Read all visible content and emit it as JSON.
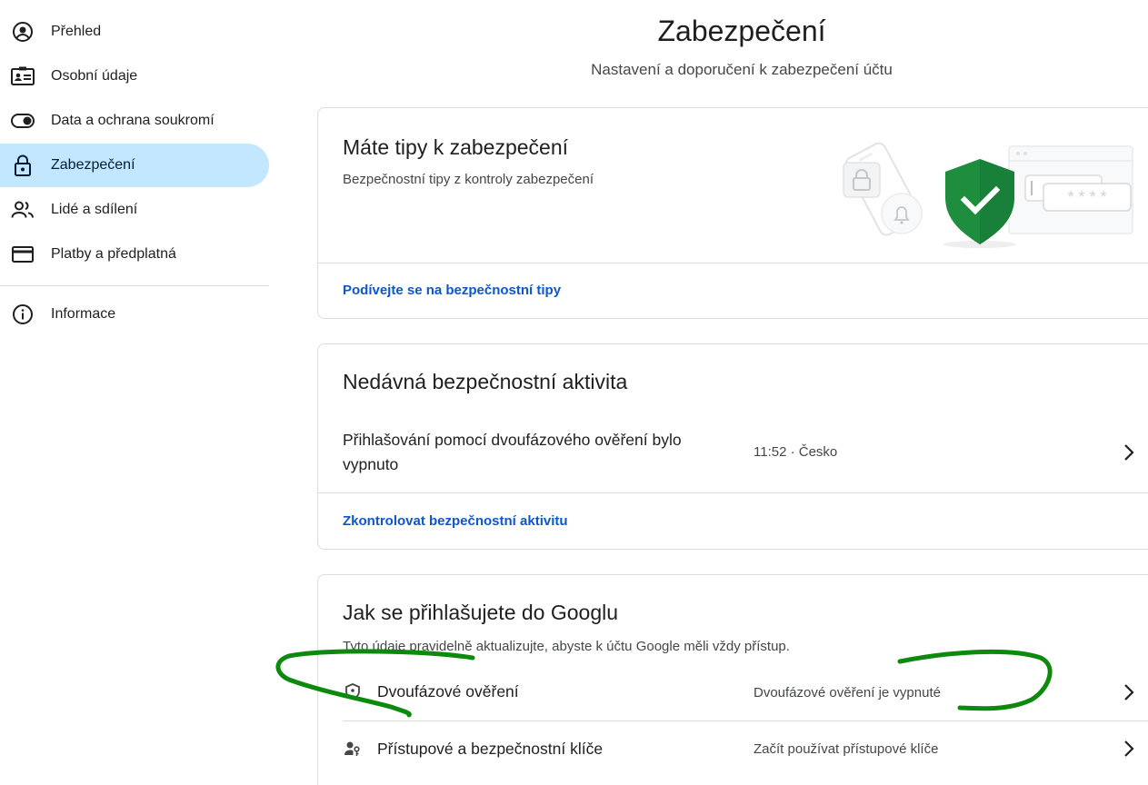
{
  "sidebar": {
    "items": [
      {
        "label": "Přehled",
        "icon": "account-circle-icon"
      },
      {
        "label": "Osobní údaje",
        "icon": "id-card-icon"
      },
      {
        "label": "Data a ochrana soukromí",
        "icon": "toggle-icon"
      },
      {
        "label": "Zabezpečení",
        "icon": "lock-icon",
        "active": true
      },
      {
        "label": "Lidé a sdílení",
        "icon": "people-icon"
      },
      {
        "label": "Platby a předplatná",
        "icon": "credit-card-icon"
      }
    ],
    "footer_items": [
      {
        "label": "Informace",
        "icon": "info-icon"
      }
    ]
  },
  "header": {
    "title": "Zabezpečení",
    "subtitle": "Nastavení a doporučení k zabezpečení účtu"
  },
  "tips_card": {
    "title": "Máte tipy k zabezpečení",
    "description": "Bezpečnostní tipy z kontroly zabezpečení",
    "link": "Podívejte se na bezpečnostní tipy",
    "illustration_password_mask": "* * * *"
  },
  "activity_card": {
    "title": "Nedávná bezpečnostní aktivita",
    "event_text": "Přihlašování pomocí dvoufázového ověření bylo vypnuto",
    "event_meta": "11:52 · Česko",
    "link": "Zkontrolovat bezpečnostní aktivitu"
  },
  "signin_card": {
    "title": "Jak se přihlašujete do Googlu",
    "description": "Tyto údaje pravidelně aktualizujte, abyste k účtu Google měli vždy přístup.",
    "rows": [
      {
        "label": "Dvoufázové ověření",
        "status": "Dvoufázové ověření je vypnuté",
        "icon": "shield-icon"
      },
      {
        "label": "Přístupové a bezpečnostní klíče",
        "status": "Začít používat přístupové klíče",
        "icon": "person-key-icon"
      }
    ]
  },
  "colors": {
    "active_nav_bg": "#c2e7ff",
    "link": "#0b57d0",
    "shield_green": "#1e8e3e",
    "annotation_green": "#0d8a0d"
  }
}
